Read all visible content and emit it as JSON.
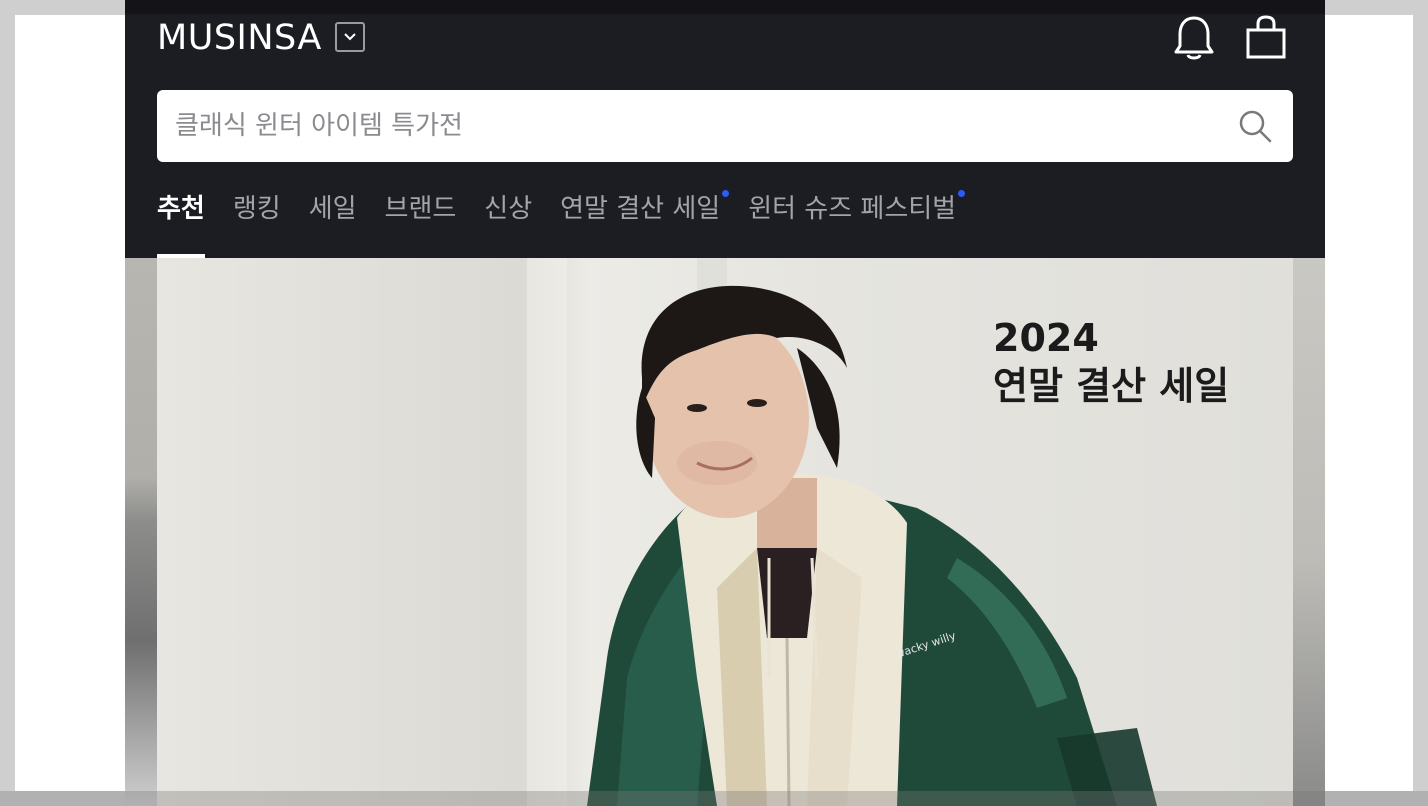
{
  "header": {
    "logo": "MUSINSA",
    "store_toggle_icon": "chevron-down-icon",
    "notification_icon": "bell-icon",
    "cart_icon": "shopping-bag-icon"
  },
  "search": {
    "placeholder": "클래식 윈터 아이템 특가전",
    "icon": "search-icon"
  },
  "tabs": [
    {
      "label": "추천",
      "active": true,
      "new_dot": false
    },
    {
      "label": "랭킹",
      "active": false,
      "new_dot": false
    },
    {
      "label": "세일",
      "active": false,
      "new_dot": false
    },
    {
      "label": "브랜드",
      "active": false,
      "new_dot": false
    },
    {
      "label": "신상",
      "active": false,
      "new_dot": false
    },
    {
      "label": "연말 결산 세일",
      "active": false,
      "new_dot": true
    },
    {
      "label": "윈터 슈즈 페스티벌",
      "active": false,
      "new_dot": true
    }
  ],
  "colors": {
    "header_bg": "#1c1d22",
    "tab_inactive": "#a3a3a8",
    "tab_active": "#ffffff",
    "new_dot": "#2c5bf6"
  },
  "hero": {
    "line1": "2024",
    "line2": "연말 결산 세일",
    "jacket_print": "wacky willy"
  }
}
